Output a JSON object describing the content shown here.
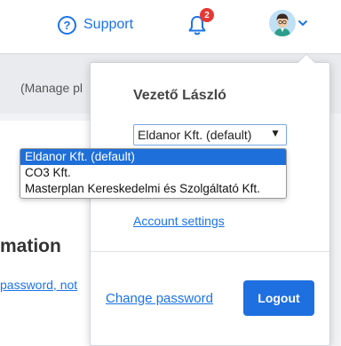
{
  "header": {
    "support_label": "Support",
    "notification_count": "2"
  },
  "background": {
    "band_text": "(Manage pl",
    "section_heading": "mation",
    "link_text": "password, not"
  },
  "user_menu": {
    "user_name": "Vezető László",
    "company_select": {
      "selected": "Eldanor Kft. (default)",
      "arrow": "▼",
      "options": [
        "Eldanor Kft. (default)",
        "CO3 Kft.",
        "Masterplan Kereskedelmi és Szolgáltató Kft."
      ]
    },
    "account_settings_label": "Account settings",
    "change_password_label": "Change password",
    "logout_label": "Logout"
  },
  "colors": {
    "accent": "#1a73e8",
    "logout_bg": "#1e6fe0",
    "badge": "#e53935",
    "selected_option": "#1e6fd9"
  }
}
